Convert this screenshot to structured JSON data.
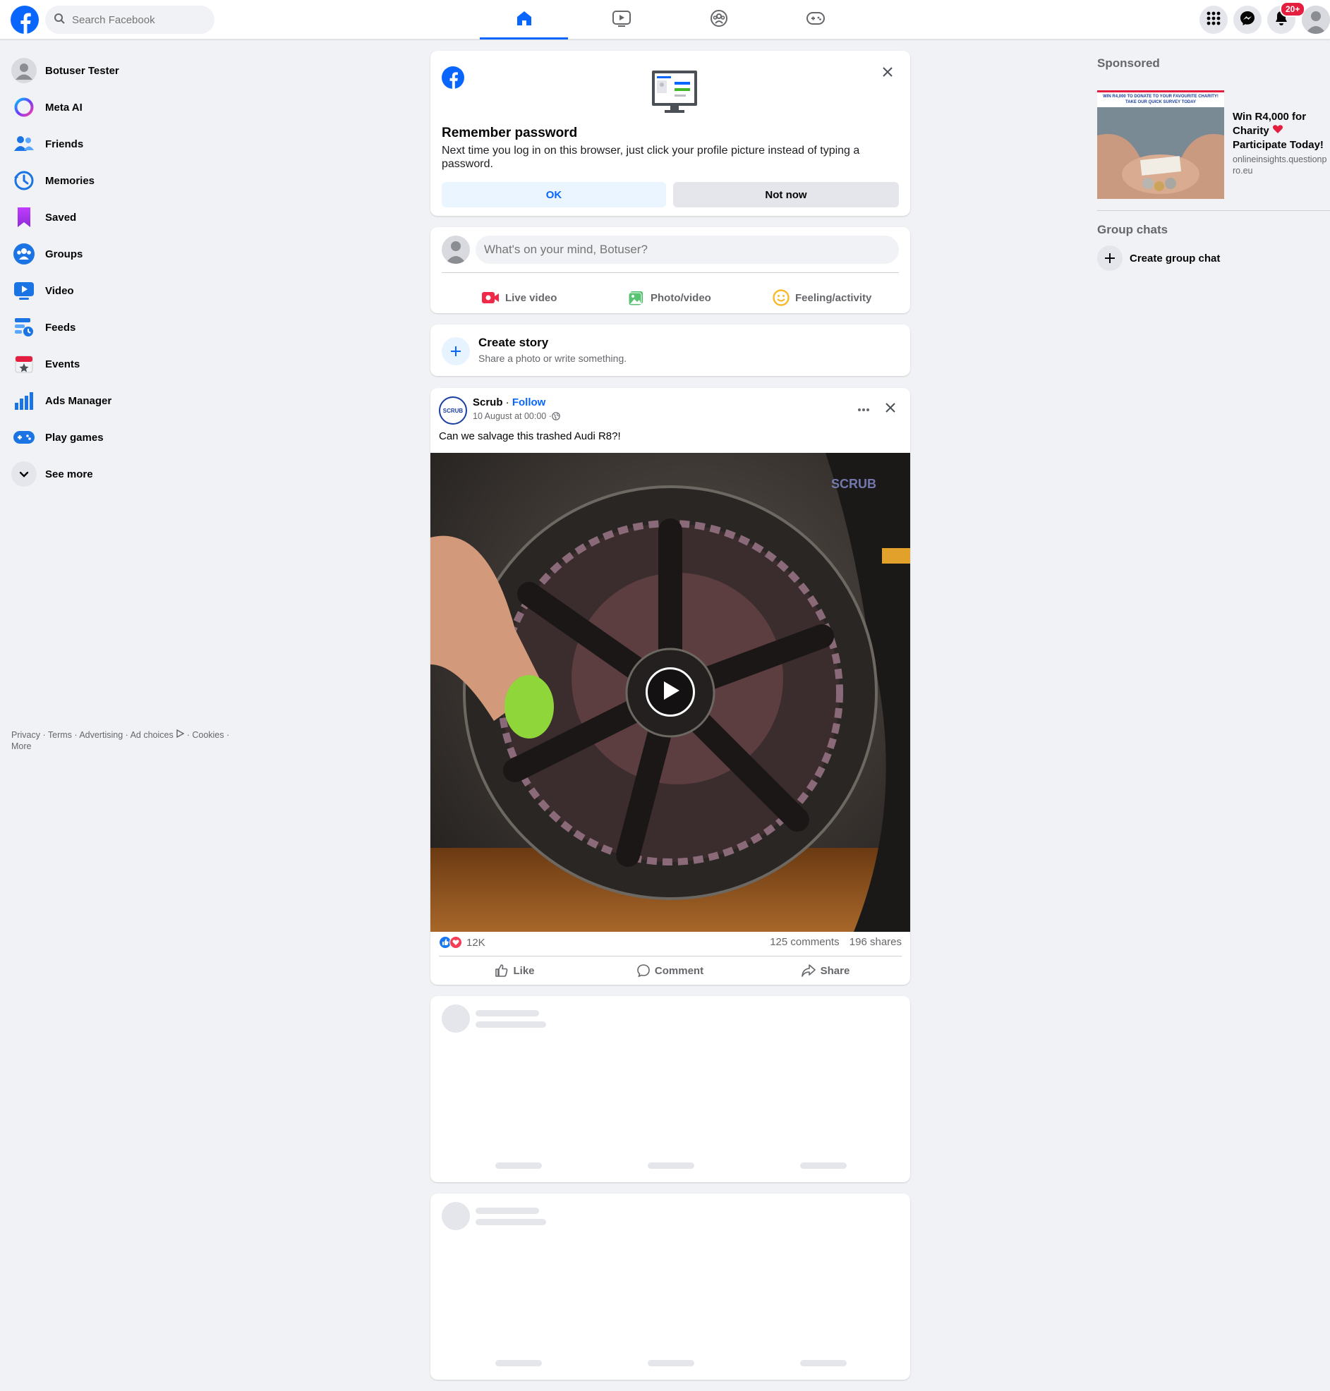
{
  "search": {
    "placeholder": "Search Facebook"
  },
  "top_right": {
    "notification_badge": "20+"
  },
  "sidebar": {
    "items": [
      {
        "label": "Botuser Tester",
        "icon": "avatar"
      },
      {
        "label": "Meta AI",
        "icon": "meta-ai-icon"
      },
      {
        "label": "Friends",
        "icon": "friends-icon"
      },
      {
        "label": "Memories",
        "icon": "memories-icon"
      },
      {
        "label": "Saved",
        "icon": "saved-icon"
      },
      {
        "label": "Groups",
        "icon": "groups-icon"
      },
      {
        "label": "Video",
        "icon": "video-icon"
      },
      {
        "label": "Feeds",
        "icon": "feeds-icon"
      },
      {
        "label": "Events",
        "icon": "events-icon"
      },
      {
        "label": "Ads Manager",
        "icon": "ads-manager-icon"
      },
      {
        "label": "Play games",
        "icon": "play-games-icon"
      },
      {
        "label": "See more",
        "icon": "chevron-down-icon"
      }
    ]
  },
  "footer": {
    "privacy": "Privacy",
    "terms": "Terms",
    "advertising": "Advertising",
    "ad_choices": "Ad choices",
    "cookies": "Cookies",
    "more": "More",
    "sep": " · "
  },
  "remember": {
    "title": "Remember password",
    "body": "Next time you log in on this browser, just click your profile picture instead of typing a password.",
    "ok": "OK",
    "not_now": "Not now"
  },
  "composer": {
    "placeholder": "What's on your mind, Botuser?",
    "live": "Live video",
    "photo": "Photo/video",
    "feeling": "Feeling/activity"
  },
  "story": {
    "title": "Create story",
    "subtitle": "Share a photo or write something."
  },
  "post": {
    "author": "Scrub",
    "dot": " · ",
    "follow": "Follow",
    "time": "10 August at 00:00 · ",
    "text": "Can we salvage this trashed Audi R8?!",
    "watermark": "SCRUB",
    "avatar_text": "SCRUB",
    "reactions": "12K",
    "comments": "125 comments",
    "shares": "196 shares",
    "like": "Like",
    "comment": "Comment",
    "share": "Share"
  },
  "right": {
    "sponsored": "Sponsored",
    "ad_banner": "WIN R4,000 TO DONATE TO YOUR FAVOURITE CHARITY! TAKE OUR QUICK SURVEY TODAY",
    "ad_title_1": "Win R4,000 for Charity",
    "ad_title_2": "Participate Today!",
    "ad_url": "onlineinsights.questionpro.eu",
    "group_chats": "Group chats",
    "create_group": "Create group chat"
  },
  "colors": {
    "brand": "#0866ff",
    "background": "#f0f2f5",
    "badge": "#e41e3f"
  }
}
